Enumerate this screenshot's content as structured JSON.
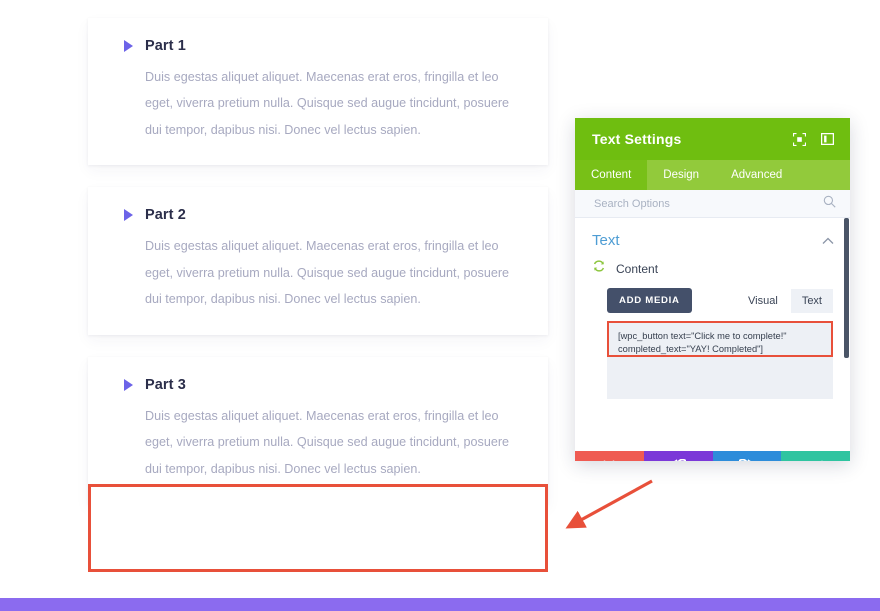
{
  "page": {
    "accordion": [
      {
        "title": "Part 1",
        "body": "Duis egestas aliquet aliquet. Maecenas erat eros, fringilla et leo eget, viverra pretium nulla. Quisque sed augue tincidunt, posuere dui tempor, dapibus nisi. Donec vel lectus sapien."
      },
      {
        "title": "Part 2",
        "body": "Duis egestas aliquet aliquet. Maecenas erat eros, fringilla et leo eget, viverra pretium nulla. Quisque sed augue tincidunt, posuere dui tempor, dapibus nisi. Donec vel lectus sapien."
      },
      {
        "title": "Part 3",
        "body": "Duis egestas aliquet aliquet. Maecenas erat eros, fringilla et leo eget, viverra pretium nulla. Quisque sed augue tincidunt, posuere dui tempor, dapibus nisi. Donec vel lectus sapien."
      }
    ],
    "empty_module": {
      "content": ""
    },
    "bottom_bar_color": "#8B6BEF"
  },
  "modal": {
    "title": "Text Settings",
    "header_icons": [
      {
        "name": "fullscreen-icon"
      },
      {
        "name": "panel-layout-icon"
      }
    ],
    "tabs": [
      {
        "label": "Content",
        "active": true
      },
      {
        "label": "Design",
        "active": false
      },
      {
        "label": "Advanced",
        "active": false
      }
    ],
    "search": {
      "placeholder": "Search Options",
      "value": "",
      "icon": "search-icon"
    },
    "section": {
      "title": "Text",
      "collapse_icon": "chevron-up-icon"
    },
    "content_field": {
      "label": "Content",
      "reset_icon": "reset-circular-arrows-icon",
      "add_media_label": "ADD MEDIA",
      "mode_tabs": [
        {
          "label": "Visual",
          "active": false
        },
        {
          "label": "Text",
          "active": true
        }
      ],
      "value": "[wpc_button text=\"Click me to complete!\"\ncompleted_text=\"YAY! Completed\"]"
    },
    "footer_buttons": [
      {
        "name": "close",
        "icon": "✖",
        "color": "#EF5B52"
      },
      {
        "name": "undo",
        "icon": "↺",
        "color": "#7B38D8"
      },
      {
        "name": "redo",
        "icon": "↻",
        "color": "#2D8CDA"
      },
      {
        "name": "save",
        "icon": "✔",
        "color": "#2FC4A0"
      }
    ]
  },
  "annotations": {
    "highlight_color": "#E8503A",
    "arrows": [
      {
        "name": "arrow-to-shortcode"
      },
      {
        "name": "arrow-to-empty-module"
      }
    ]
  }
}
